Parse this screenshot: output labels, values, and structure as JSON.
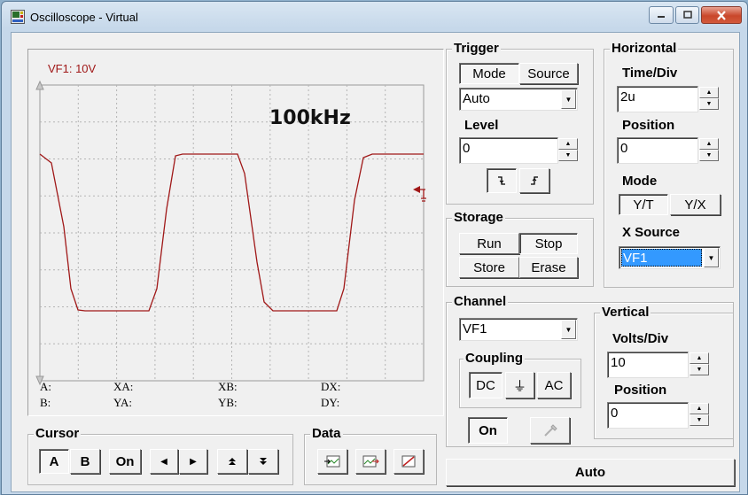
{
  "window": {
    "title": "Oscilloscope - Virtual"
  },
  "display": {
    "channel_label": "VF1: 10V",
    "annotation": "100kHz",
    "readouts": [
      {
        "label": "A:",
        "value": ""
      },
      {
        "label": "XA:",
        "value": ""
      },
      {
        "label": "XB:",
        "value": ""
      },
      {
        "label": "DX:",
        "value": ""
      },
      {
        "label": "B:",
        "value": ""
      },
      {
        "label": "YA:",
        "value": ""
      },
      {
        "label": "YB:",
        "value": ""
      },
      {
        "label": "DY:",
        "value": ""
      }
    ],
    "trace_color": "#a01818"
  },
  "trigger": {
    "title": "Trigger",
    "mode_tab": "Mode",
    "source_tab": "Source",
    "mode_value": "Auto",
    "level_label": "Level",
    "level_value": "0"
  },
  "horizontal": {
    "title": "Horizontal",
    "time_div_label": "Time/Div",
    "time_div_value": "2u",
    "position_label": "Position",
    "position_value": "0",
    "mode_label": "Mode",
    "mode_yt": "Y/T",
    "mode_yx": "Y/X",
    "x_source_label": "X Source",
    "x_source_value": "VF1"
  },
  "storage": {
    "title": "Storage",
    "run": "Run",
    "stop": "Stop",
    "store": "Store",
    "erase": "Erase"
  },
  "channel": {
    "title": "Channel",
    "value": "VF1",
    "coupling_title": "Coupling",
    "dc": "DC",
    "gnd": "⏚",
    "ac": "AC",
    "on": "On"
  },
  "vertical": {
    "title": "Vertical",
    "volts_div_label": "Volts/Div",
    "volts_div_value": "10",
    "position_label": "Position",
    "position_value": "0"
  },
  "cursor": {
    "title": "Cursor",
    "a": "A",
    "b": "B",
    "on": "On"
  },
  "data": {
    "title": "Data"
  },
  "auto": "Auto",
  "colors": {
    "selection": "#3399ff",
    "titlebar": "#c6d8ea",
    "close": "#c9472b"
  }
}
